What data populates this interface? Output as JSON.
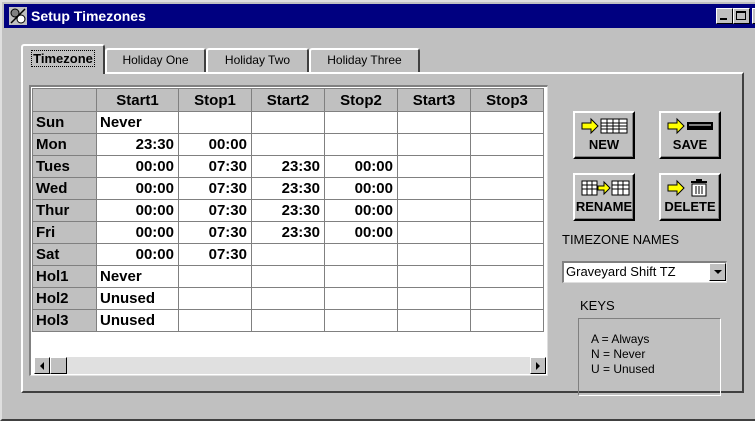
{
  "window": {
    "title": "Setup Timezones"
  },
  "tabs": [
    {
      "label": "Timezone",
      "active": true
    },
    {
      "label": "Holiday One",
      "active": false
    },
    {
      "label": "Holiday Two",
      "active": false
    },
    {
      "label": "Holiday Three",
      "active": false
    }
  ],
  "grid": {
    "columns": [
      "Start1",
      "Stop1",
      "Start2",
      "Stop2",
      "Start3",
      "Stop3"
    ],
    "rows": [
      {
        "label": "Sun",
        "cells": [
          "Never",
          "",
          "",
          "",
          "",
          ""
        ]
      },
      {
        "label": "Mon",
        "cells": [
          "23:30",
          "00:00",
          "",
          "",
          "",
          ""
        ]
      },
      {
        "label": "Tues",
        "cells": [
          "00:00",
          "07:30",
          "23:30",
          "00:00",
          "",
          ""
        ]
      },
      {
        "label": "Wed",
        "cells": [
          "00:00",
          "07:30",
          "23:30",
          "00:00",
          "",
          ""
        ]
      },
      {
        "label": "Thur",
        "cells": [
          "00:00",
          "07:30",
          "23:30",
          "00:00",
          "",
          ""
        ]
      },
      {
        "label": "Fri",
        "cells": [
          "00:00",
          "07:30",
          "23:30",
          "00:00",
          "",
          ""
        ]
      },
      {
        "label": "Sat",
        "cells": [
          "00:00",
          "07:30",
          "",
          "",
          "",
          ""
        ]
      },
      {
        "label": "Hol1",
        "cells": [
          "Never",
          "",
          "",
          "",
          "",
          ""
        ]
      },
      {
        "label": "Hol2",
        "cells": [
          "Unused",
          "",
          "",
          "",
          "",
          ""
        ]
      },
      {
        "label": "Hol3",
        "cells": [
          "Unused",
          "",
          "",
          "",
          "",
          ""
        ]
      }
    ]
  },
  "buttons": {
    "new": "NEW",
    "save": "SAVE",
    "rename": "RENAME",
    "delete": "DELETE"
  },
  "timezone_names": {
    "label": "TIMEZONE NAMES",
    "selected": "Graveyard Shift TZ"
  },
  "keys": {
    "title": "KEYS",
    "lines": [
      "A = Always",
      "N = Never",
      "U = Unused"
    ]
  },
  "colors": {
    "titlebar": "#000080",
    "face": "#c0c0c0",
    "arrow": "#ffff00"
  }
}
